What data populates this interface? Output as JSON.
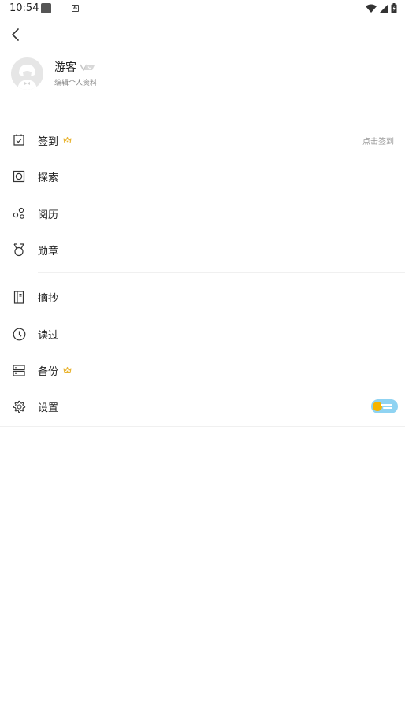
{
  "status_bar": {
    "time": "10:54",
    "notification_letter": "A",
    "icons": [
      "notification-square-icon",
      "a-badge-icon",
      "wifi-icon",
      "signal-icon",
      "battery-icon"
    ]
  },
  "nav": {
    "back_icon": "back-arrow-icon"
  },
  "profile": {
    "name": "游客",
    "edit_label": "编辑个人资料",
    "avatar_icon": "default-avatar-icon",
    "badge_icon": "vip-badge-icon"
  },
  "menu": {
    "items": [
      {
        "label": "签到",
        "icon": "checkin-calendar-icon",
        "crown": true,
        "right_text": "点击签到"
      },
      {
        "label": "探索",
        "icon": "explore-square-icon",
        "crown": false
      },
      {
        "label": "阅历",
        "icon": "history-bubbles-icon",
        "crown": false
      },
      {
        "label": "勋章",
        "icon": "medal-icon",
        "crown": false
      },
      {
        "label": "摘抄",
        "icon": "notebook-icon",
        "crown": false
      },
      {
        "label": "读过",
        "icon": "clock-icon",
        "crown": false
      },
      {
        "label": "备份",
        "icon": "backup-server-icon",
        "crown": true
      },
      {
        "label": "设置",
        "icon": "gear-icon",
        "crown": false,
        "toggle": "theme-toggle"
      }
    ]
  },
  "colors": {
    "accent_crown": "#e9b431",
    "toggle_bg": "#8fd3f2",
    "toggle_knob": "#f6b400",
    "icon": "#333333",
    "secondary_text": "#999999"
  }
}
